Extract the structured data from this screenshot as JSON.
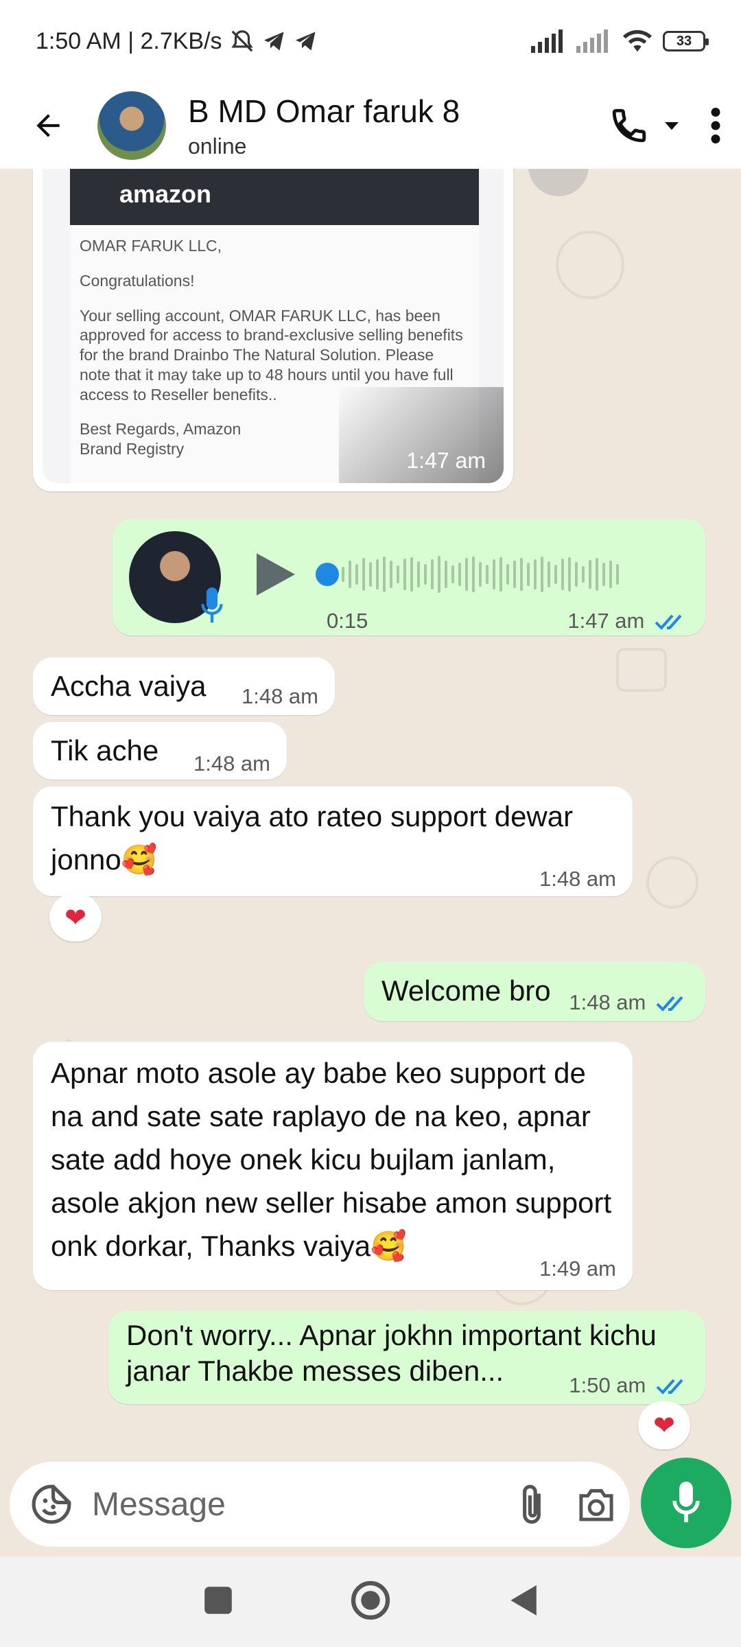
{
  "status_bar": {
    "time_speed": "1:50 AM | 2.7KB/s",
    "battery": "33"
  },
  "header": {
    "contact_name": "B MD Omar faruk 8",
    "contact_status": "online"
  },
  "messages": {
    "image_card": {
      "brand": "amazon",
      "lines": [
        "OMAR FARUK LLC,",
        "Congratulations!",
        "Your selling account, OMAR FARUK LLC, has been approved for access to brand-exclusive selling benefits for the brand Drainbo The Natural Solution. Please note that it may take up to 48 hours until you have full access to Reseller benefits..",
        "Best Regards, Amazon Brand Registry"
      ],
      "time": "1:47 am"
    },
    "voice": {
      "duration": "0:15",
      "time": "1:47 am"
    },
    "m1": {
      "text": "Accha vaiya",
      "time": "1:48 am"
    },
    "m2": {
      "text": "Tik ache",
      "time": "1:48 am"
    },
    "m3": {
      "text": "Thank you vaiya ato rateo support dewar jonno🥰",
      "time": "1:48 am",
      "reaction": "❤"
    },
    "m4": {
      "text": "Welcome bro",
      "time": "1:48 am"
    },
    "m5": {
      "text": "Apnar moto asole ay babe keo support de na and sate sate raplayo de na keo, apnar sate add hoye onek kicu bujlam janlam, asole akjon new seller hisabe amon support onk dorkar, Thanks vaiya🥰",
      "time": "1:49 am"
    },
    "m6": {
      "text": "Don't worry... Apnar jokhn important kichu janar Thakbe messes diben...",
      "time": "1:50 am",
      "reaction": "❤"
    }
  },
  "composer": {
    "placeholder": "Message"
  },
  "colors": {
    "accent_green": "#1daa61",
    "outgoing_bubble": "#d9fdd3",
    "read_tick_blue": "#1e88e5"
  }
}
